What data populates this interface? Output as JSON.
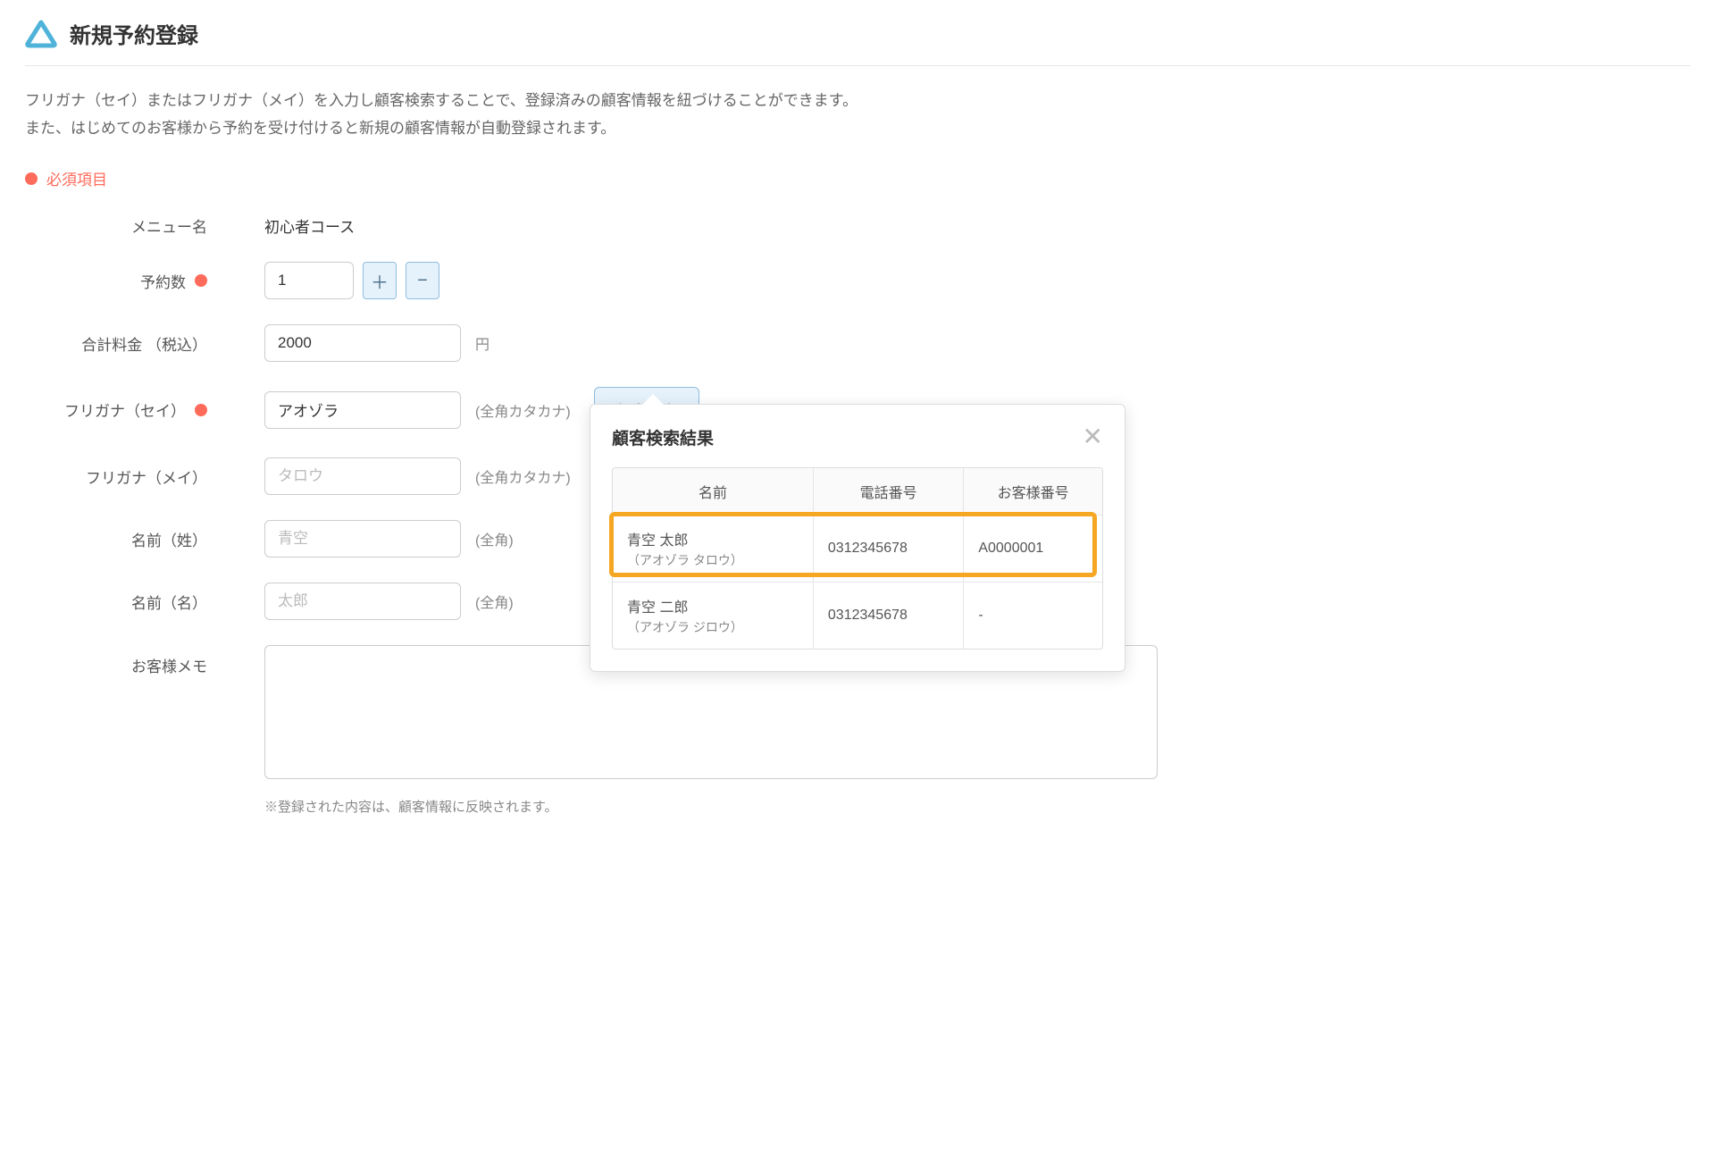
{
  "header": {
    "title": "新規予約登録"
  },
  "description": {
    "line1": "フリガナ（セイ）またはフリガナ（メイ）を入力し顧客検索することで、登録済みの顧客情報を紐づけることができます。",
    "line2": "また、はじめてのお客様から予約を受け付けると新規の顧客情報が自動登録されます。"
  },
  "required_legend": "必須項目",
  "form": {
    "menu_name": {
      "label": "メニュー名",
      "value": "初心者コース"
    },
    "reservation_count": {
      "label": "予約数",
      "value": "1",
      "plus": "＋",
      "minus": "−"
    },
    "total_price": {
      "label": "合計料金 （税込）",
      "value": "2000",
      "unit": "円"
    },
    "furigana_sei": {
      "label": "フリガナ（セイ）",
      "value": "アオゾラ",
      "hint": "(全角カタカナ)",
      "search_button": "顧客検索"
    },
    "furigana_mei": {
      "label": "フリガナ（メイ）",
      "placeholder": "タロウ",
      "hint": "(全角カタカナ)"
    },
    "name_sei": {
      "label": "名前（姓）",
      "placeholder": "青空",
      "hint": "(全角)"
    },
    "name_mei": {
      "label": "名前（名）",
      "placeholder": "太郎",
      "hint": "(全角)"
    },
    "memo": {
      "label": "お客様メモ"
    },
    "footnote": "※登録された内容は、顧客情報に反映されます。"
  },
  "popover": {
    "title": "顧客検索結果",
    "columns": {
      "name": "名前",
      "phone": "電話番号",
      "customer_no": "お客様番号"
    },
    "rows": [
      {
        "name": "青空 太郎",
        "kana": "（アオゾラ タロウ）",
        "phone": "0312345678",
        "customer_no": "A0000001",
        "highlighted": true
      },
      {
        "name": "青空 二郎",
        "kana": "（アオゾラ ジロウ）",
        "phone": "0312345678",
        "customer_no": "-",
        "highlighted": false
      }
    ]
  }
}
